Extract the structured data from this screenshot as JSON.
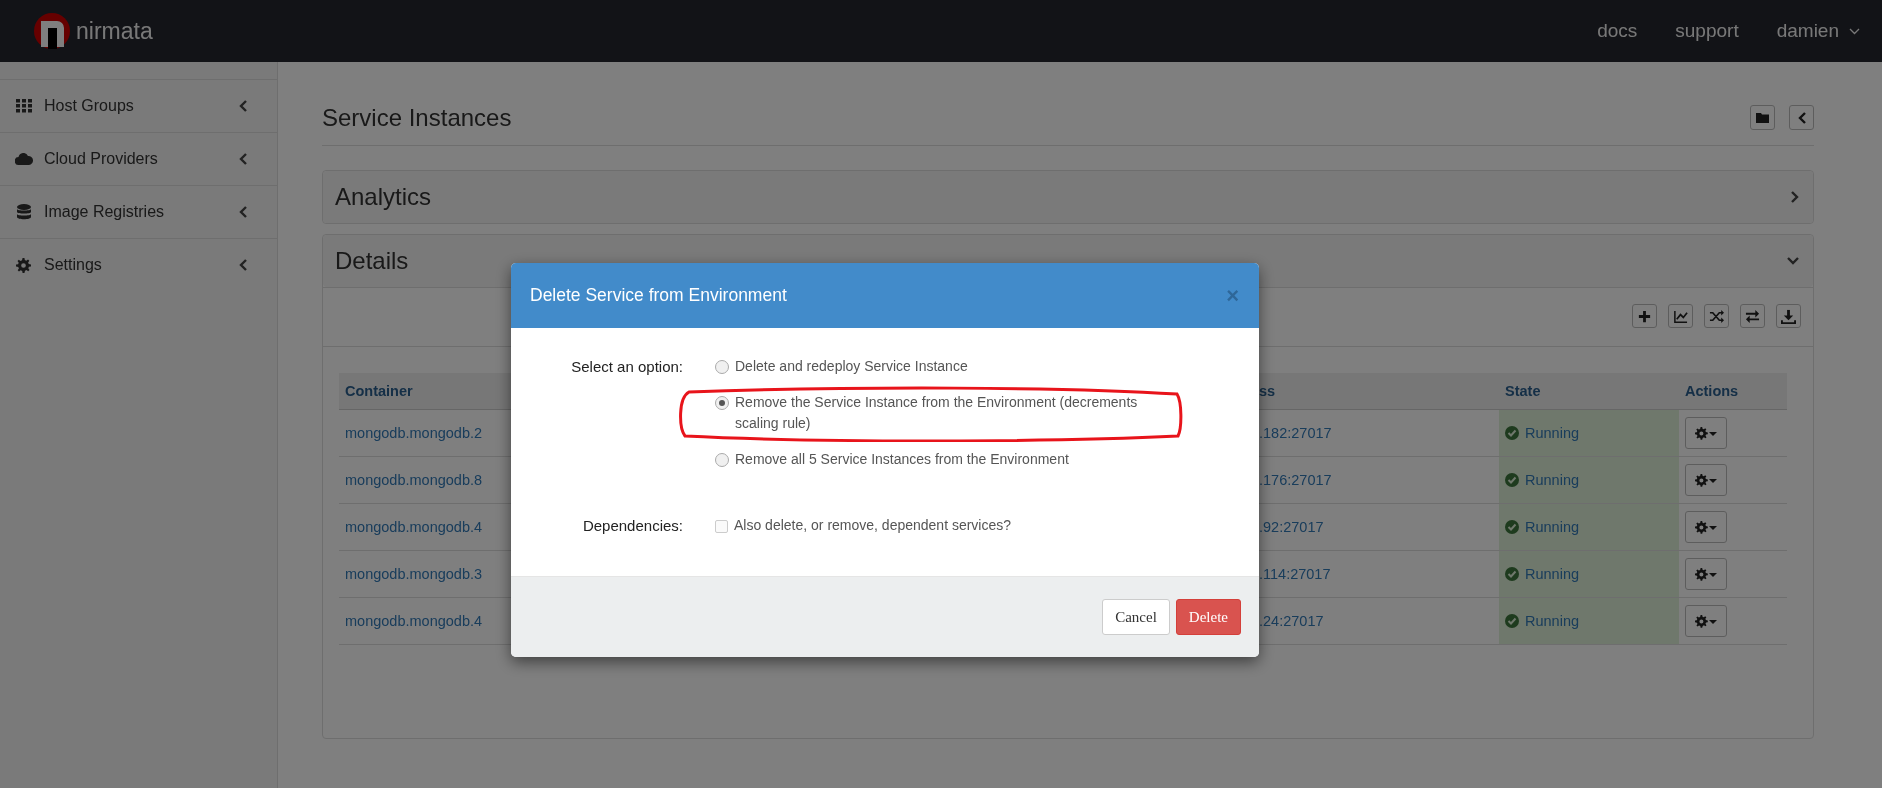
{
  "topbar": {
    "brand": "nirmata",
    "links": [
      {
        "label": "docs",
        "kind": "link"
      },
      {
        "label": "support",
        "kind": "link"
      },
      {
        "label": "damien",
        "kind": "dropdown"
      }
    ]
  },
  "sidebar": {
    "items": [
      {
        "label": "Host Groups",
        "kind": "grid",
        "expanded": false
      },
      {
        "label": "Cloud Providers",
        "kind": "cloud",
        "expanded": false
      },
      {
        "label": "Image Registries",
        "kind": "database",
        "expanded": false
      },
      {
        "label": "Settings",
        "kind": "gear",
        "expanded": false
      }
    ]
  },
  "page": {
    "title": "Service Instances",
    "panels": [
      {
        "title": "Analytics",
        "expanded": false
      },
      {
        "title": "Details",
        "expanded": true
      }
    ]
  },
  "table": {
    "columns": [
      "Container",
      "ss",
      "State",
      "Actions"
    ],
    "rows": [
      {
        "container": "mongodb.mongodb.2",
        "address": ".182:27017",
        "state": "Running"
      },
      {
        "container": "mongodb.mongodb.8",
        "address": ".176:27017",
        "state": "Running"
      },
      {
        "container": "mongodb.mongodb.4",
        "address": ".92:27017",
        "state": "Running"
      },
      {
        "container": "mongodb.mongodb.3",
        "address": ".114:27017",
        "state": "Running"
      },
      {
        "container": "mongodb.mongodb.4",
        "address": ".24:27017",
        "state": "Running"
      }
    ]
  },
  "dialog": {
    "title": "Delete Service from Environment",
    "close": "×",
    "option_label": "Select an option:",
    "options": [
      {
        "label": "Delete and redeploy Service Instance",
        "selected": false,
        "highlighted": false
      },
      {
        "label": "Remove the Service Instance from the Environment (decrements scaling rule)",
        "selected": true,
        "highlighted": true
      },
      {
        "label": "Remove all 5 Service Instances from the Environment",
        "selected": false,
        "highlighted": false
      }
    ],
    "dependencies_label": "Dependencies:",
    "dependency": {
      "label": "Also delete, or remove, dependent services?",
      "checked": false
    },
    "buttons": [
      {
        "label": "Cancel",
        "kind": "default"
      },
      {
        "label": "Delete",
        "kind": "danger"
      }
    ]
  }
}
